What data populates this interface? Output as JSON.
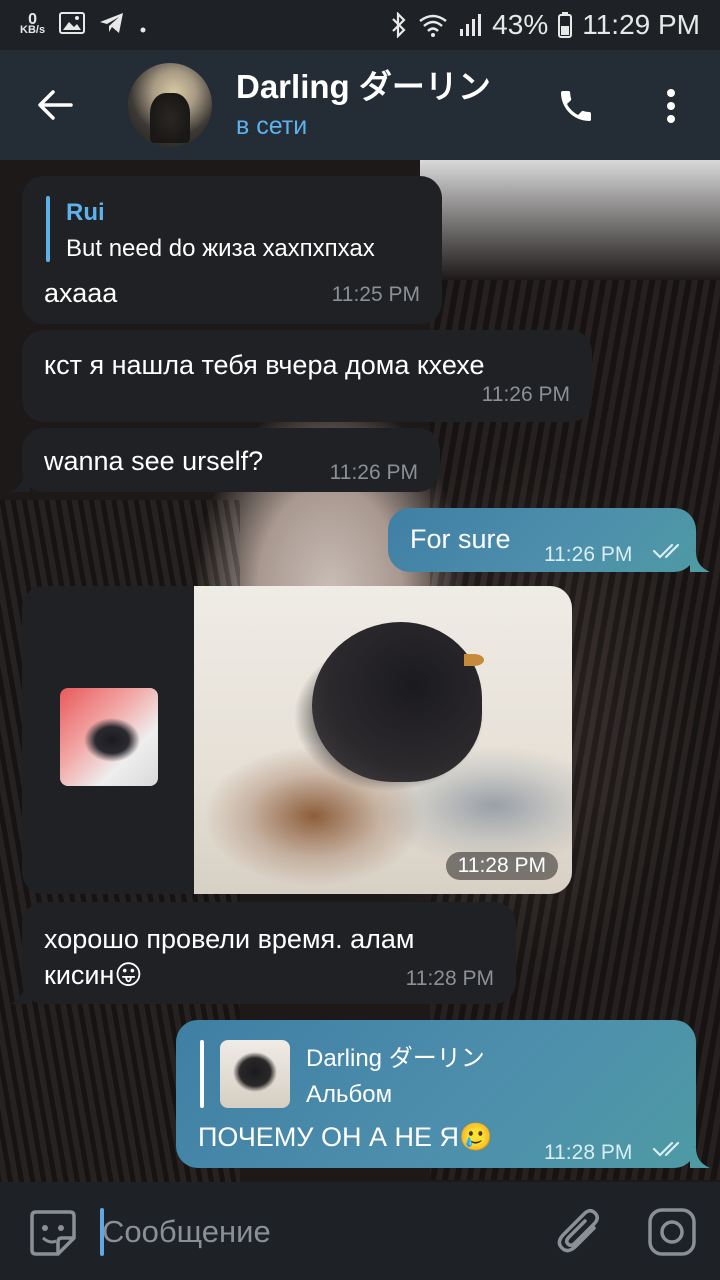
{
  "status_bar": {
    "kbs_value": "0",
    "kbs_unit": "KB/s",
    "battery": "43%",
    "time": "11:29 PM"
  },
  "header": {
    "contact_name": "Darling ダーリン",
    "contact_status": "в сети"
  },
  "messages": [
    {
      "direction": "in",
      "reply_to_name": "Rui",
      "reply_to_text": "But need do жиза хахпхпхах",
      "text": "ахааа",
      "time": "11:25 PM"
    },
    {
      "direction": "in",
      "text": "кст я нашла тебя вчера дома кхехе",
      "time": "11:26 PM"
    },
    {
      "direction": "in",
      "text": "wanna see urself?",
      "time": "11:26 PM"
    },
    {
      "direction": "out",
      "text": "For sure",
      "time": "11:26 PM",
      "read": true
    },
    {
      "direction": "in",
      "type": "album",
      "time": "11:28 PM"
    },
    {
      "direction": "in",
      "text_line1": "хорошо провели время. алам",
      "text_line2": "кисин😛",
      "time": "11:28 PM"
    },
    {
      "direction": "out",
      "reply_to_name": "Darling ダーリン",
      "reply_to_text": "Альбом",
      "text": "ПОЧЕМУ ОН А НЕ Я🥲",
      "time": "11:28 PM",
      "read": true
    }
  ],
  "input": {
    "placeholder": "Сообщение"
  },
  "colors": {
    "accent_blue": "#5fb1ec",
    "outgoing_bubble": "#4a8aab",
    "incoming_bubble": "#1f2124",
    "header_bg": "#242d36"
  },
  "icons": [
    "back-arrow-icon",
    "phone-icon",
    "more-vert-icon",
    "sticker-emoji-icon",
    "paperclip-icon",
    "camera-icon"
  ]
}
